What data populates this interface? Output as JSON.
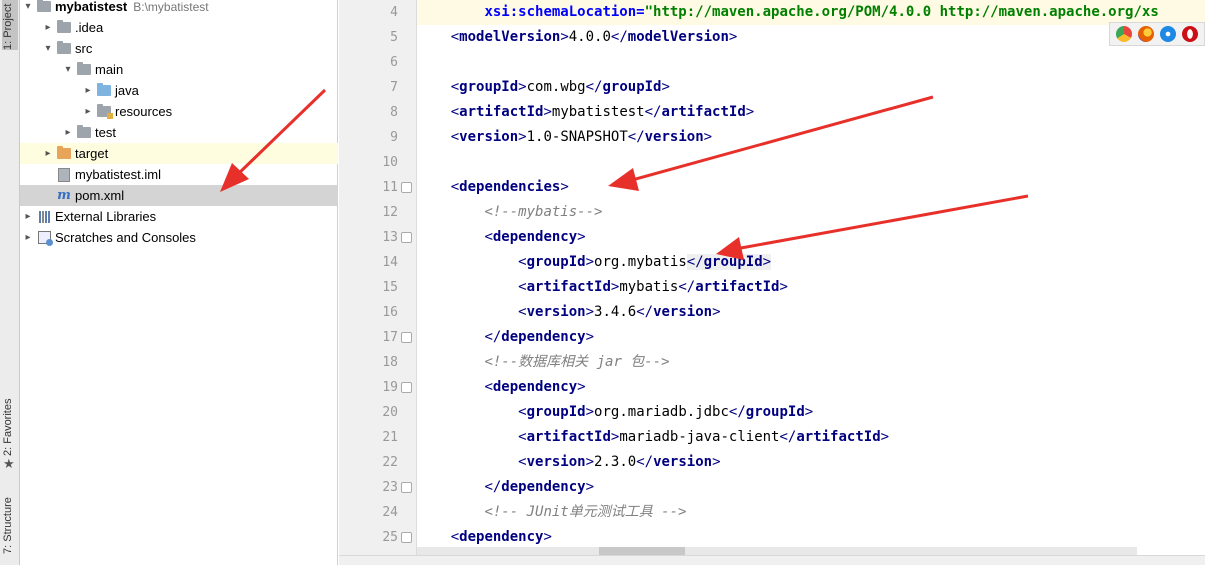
{
  "stripe": {
    "project_tab": "1: Project",
    "favorites_tab": "2: Favorites",
    "structure_tab": "7: Structure"
  },
  "tree": {
    "root_name": "mybatistest",
    "root_path": "B:\\mybatistest",
    "items": [
      {
        "label": "mybatistest",
        "icon": "folder-icon"
      },
      {
        "label": ".idea",
        "icon": "folder-icon"
      },
      {
        "label": "src",
        "icon": "folder-icon"
      },
      {
        "label": "main",
        "icon": "folder-icon"
      },
      {
        "label": "java",
        "icon": "source-folder-icon"
      },
      {
        "label": "resources",
        "icon": "resources-folder-icon"
      },
      {
        "label": "test",
        "icon": "folder-icon"
      },
      {
        "label": "target",
        "icon": "excluded-folder-icon"
      },
      {
        "label": "mybatistest.iml",
        "icon": "module-file-icon"
      },
      {
        "label": "pom.xml",
        "icon": "maven-file-icon"
      },
      {
        "label": "External Libraries",
        "icon": "library-icon"
      },
      {
        "label": "Scratches and Consoles",
        "icon": "scratches-icon"
      }
    ]
  },
  "editor": {
    "line_numbers": [
      "4",
      "5",
      "6",
      "7",
      "8",
      "9",
      "10",
      "11",
      "12",
      "13",
      "14",
      "15",
      "16",
      "17",
      "18",
      "19",
      "20",
      "21",
      "22",
      "23",
      "24",
      "25"
    ],
    "lines": {
      "l4_attr": "xsi:schemaLocation=",
      "l4_val": "\"http://maven.apache.org/POM/4.0.0 http://maven.apache.org/xs",
      "l5_tag": "modelVersion",
      "l5_text": "4.0.0",
      "l7_tag": "groupId",
      "l7_text": "com.wbg",
      "l8_tag": "artifactId",
      "l8_text": "mybatistest",
      "l9_tag": "version",
      "l9_text": "1.0-SNAPSHOT",
      "l11_tag": "dependencies",
      "l12_comment": "<!--mybatis-->",
      "l13_tag": "dependency",
      "l14_tag": "groupId",
      "l14_text": "org.mybatis",
      "l15_tag": "artifactId",
      "l15_text": "mybatis",
      "l16_tag": "version",
      "l16_text": "3.4.6",
      "l17_tag": "dependency",
      "l18_comment": "<!--数据库相关 jar 包-->",
      "l19_tag": "dependency",
      "l20_tag": "groupId",
      "l20_text": "org.mariadb.jdbc",
      "l21_tag": "artifactId",
      "l21_text": "mariadb-java-client",
      "l22_tag": "version",
      "l22_text": "2.3.0",
      "l23_tag": "dependency",
      "l24_comment": "<!-- JUnit单元测试工具 -->",
      "l25_tag": "dependency"
    }
  },
  "browsers": [
    {
      "name": "chrome-icon",
      "color": "#e8453c"
    },
    {
      "name": "firefox-icon",
      "color": "#e66000"
    },
    {
      "name": "safari-icon",
      "color": "#1e88e5"
    },
    {
      "name": "opera-icon",
      "color": "#cc0f16"
    }
  ],
  "colors": {
    "tag": "#000080",
    "attribute": "#0000ff",
    "value": "#008000",
    "comment": "#808080",
    "annotation_arrow": "#e8302a",
    "selection": "#d4d4d4"
  }
}
